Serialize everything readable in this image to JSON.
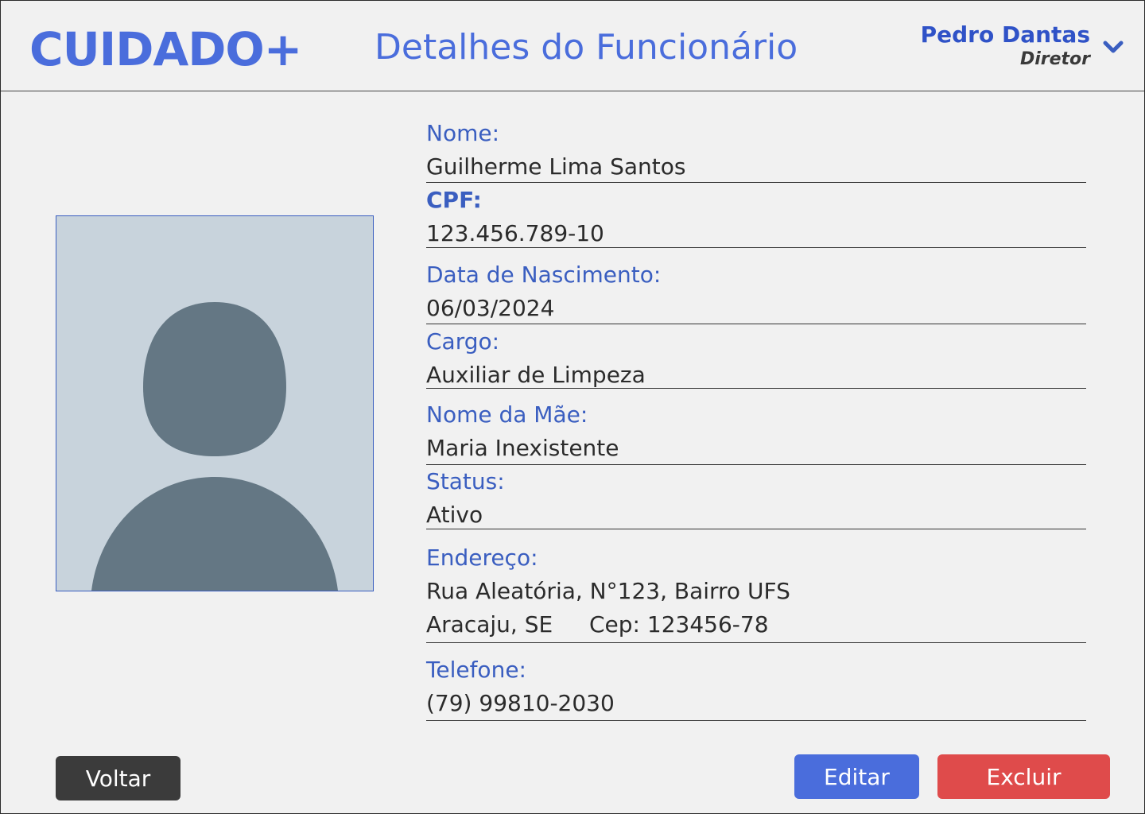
{
  "app": {
    "logo": "CUIDADO+",
    "title": "Detalhes do Funcionário"
  },
  "user": {
    "name": "Pedro Dantas",
    "role": "Diretor",
    "menu_icon": "chevron-down-icon"
  },
  "photo": {
    "icon": "avatar-placeholder-icon"
  },
  "fields": {
    "nome": {
      "label": "Nome:",
      "value": "Guilherme Lima Santos"
    },
    "cpf": {
      "label": "CPF:",
      "value": "123.456.789-10"
    },
    "nascimento": {
      "label": "Data de Nascimento:",
      "value": "06/03/2024"
    },
    "cargo": {
      "label": "Cargo:",
      "value": "Auxiliar de Limpeza"
    },
    "mae": {
      "label": "Nome da Mãe:",
      "value": "Maria Inexistente"
    },
    "status": {
      "label": "Status:",
      "value": "Ativo"
    },
    "endereco": {
      "label": "Endereço:",
      "line1": "Rua Aleatória, N°123, Bairro UFS",
      "city": "Aracaju, SE",
      "cep": "Cep: 123456-78"
    },
    "telefone": {
      "label": "Telefone:",
      "value": "(79) 99810-2030"
    }
  },
  "actions": {
    "back": "Voltar",
    "edit": "Editar",
    "delete": "Excluir"
  },
  "colors": {
    "accent": "#4a6ddc",
    "danger": "#df4b4b",
    "dark": "#3b3b3b",
    "photo_bg": "#c8d3dc",
    "avatar": "#647784"
  }
}
